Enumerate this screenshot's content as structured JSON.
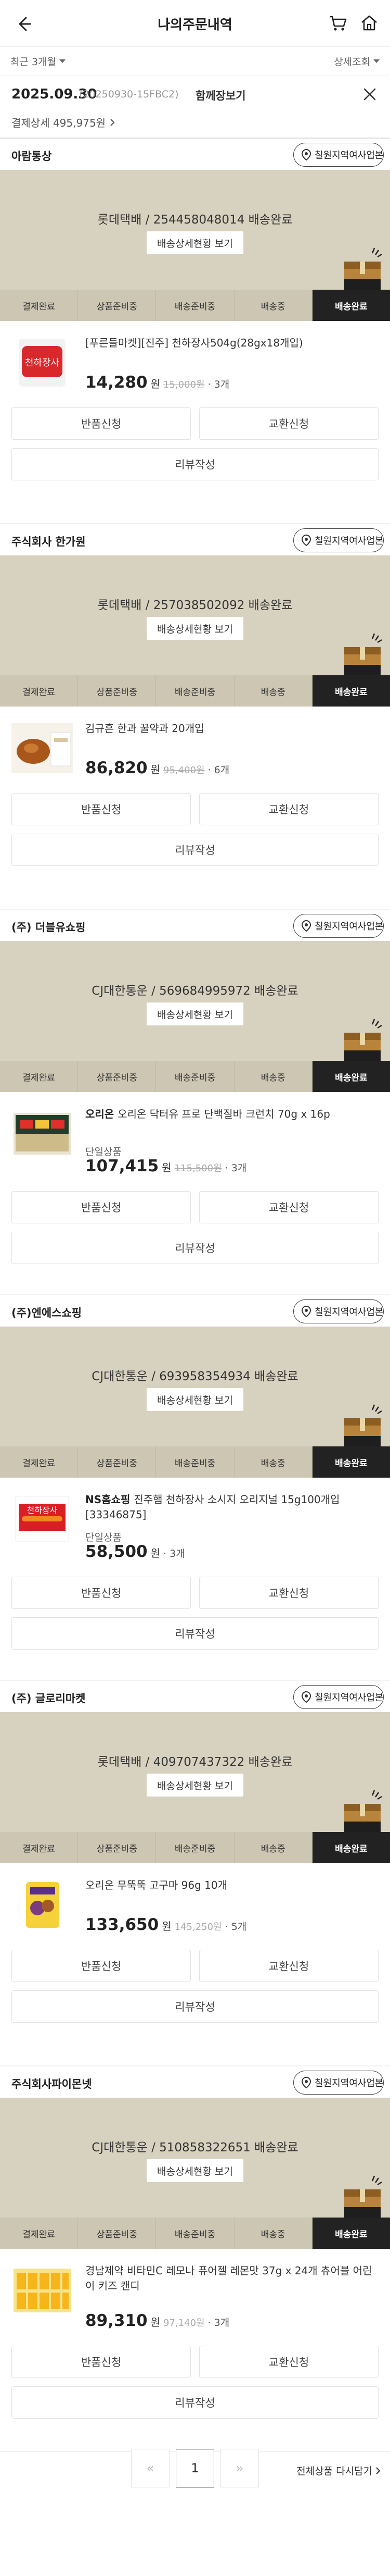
{
  "header": {
    "title": "나의주문내역"
  },
  "filters": {
    "period": "최근 3개월",
    "detail": "상세조회"
  },
  "order": {
    "date": "2025.09.30",
    "number": "(20250930-15FBC2)",
    "merge_label": "함께장보기",
    "payment_label": "결제상세 495,975원"
  },
  "steps": [
    "결제완료",
    "상품준비중",
    "배송준비중",
    "배송중",
    "배송완료"
  ],
  "location_label": "칠원지역여사업본부",
  "tracking_label": "배송상세현황 보기",
  "actions": {
    "return": "반품신청",
    "exchange": "교환신청",
    "review": "리뷰작성"
  },
  "currency": "원",
  "shops": [
    {
      "name": "아람통상",
      "shipping": "롯데택배 / 254458048014 배송완료",
      "product": {
        "seller": "",
        "title": "[푸른들마켓][진주] 천하장사504g(28gx18개입)",
        "option": "",
        "price": "14,280",
        "original": "15,000원",
        "qty": "3개"
      }
    },
    {
      "name": "주식회사 한가원",
      "shipping": "롯데택배 / 257038502092 배송완료",
      "product": {
        "seller": "",
        "title": "김규흔 한과 꿀약과 20개입",
        "option": "",
        "price": "86,820",
        "original": "95,400원",
        "qty": "6개"
      }
    },
    {
      "name": "(주) 더블유쇼핑",
      "shipping": "CJ대한통운 / 569684995972 배송완료",
      "product": {
        "seller": "오리온",
        "title": "오리온 닥터유 프로 단백질바 크런치 70g x 16p",
        "option": "단일상품",
        "price": "107,415",
        "original": "115,500원",
        "qty": "3개"
      }
    },
    {
      "name": "(주)엔에스쇼핑",
      "shipping": "CJ대한통운 / 693958354934 배송완료",
      "product": {
        "seller": "NS홈쇼핑",
        "title": "진주햄 천하장사 소시지 오리지널 15g100개입[33346875]",
        "option": "단일상품",
        "price": "58,500",
        "original": "",
        "qty": "3개"
      }
    },
    {
      "name": "(주) 글로리마켓",
      "shipping": "롯데택배 / 409707437322 배송완료",
      "product": {
        "seller": "",
        "title": "오리온 무뚝뚝 고구마 96g 10개",
        "option": "",
        "price": "133,650",
        "original": "145,250원",
        "qty": "5개"
      }
    },
    {
      "name": "주식회사파이몬넷",
      "shipping": "CJ대한통운 / 510858322651 배송완료",
      "product": {
        "seller": "",
        "title": "경남제약 비타민C 레모나 퓨어젤 레몬맛 37g x 24개 츄어블 어린이 키즈 캔디",
        "option": "",
        "price": "89,310",
        "original": "97,140원",
        "qty": "3개"
      }
    }
  ],
  "view_all": "전체상품 다시담기",
  "pager": {
    "current": "1"
  },
  "colors": {
    "panel": "#d7d1bf",
    "steps": "#ccc6b3",
    "active_step": "#222222"
  }
}
